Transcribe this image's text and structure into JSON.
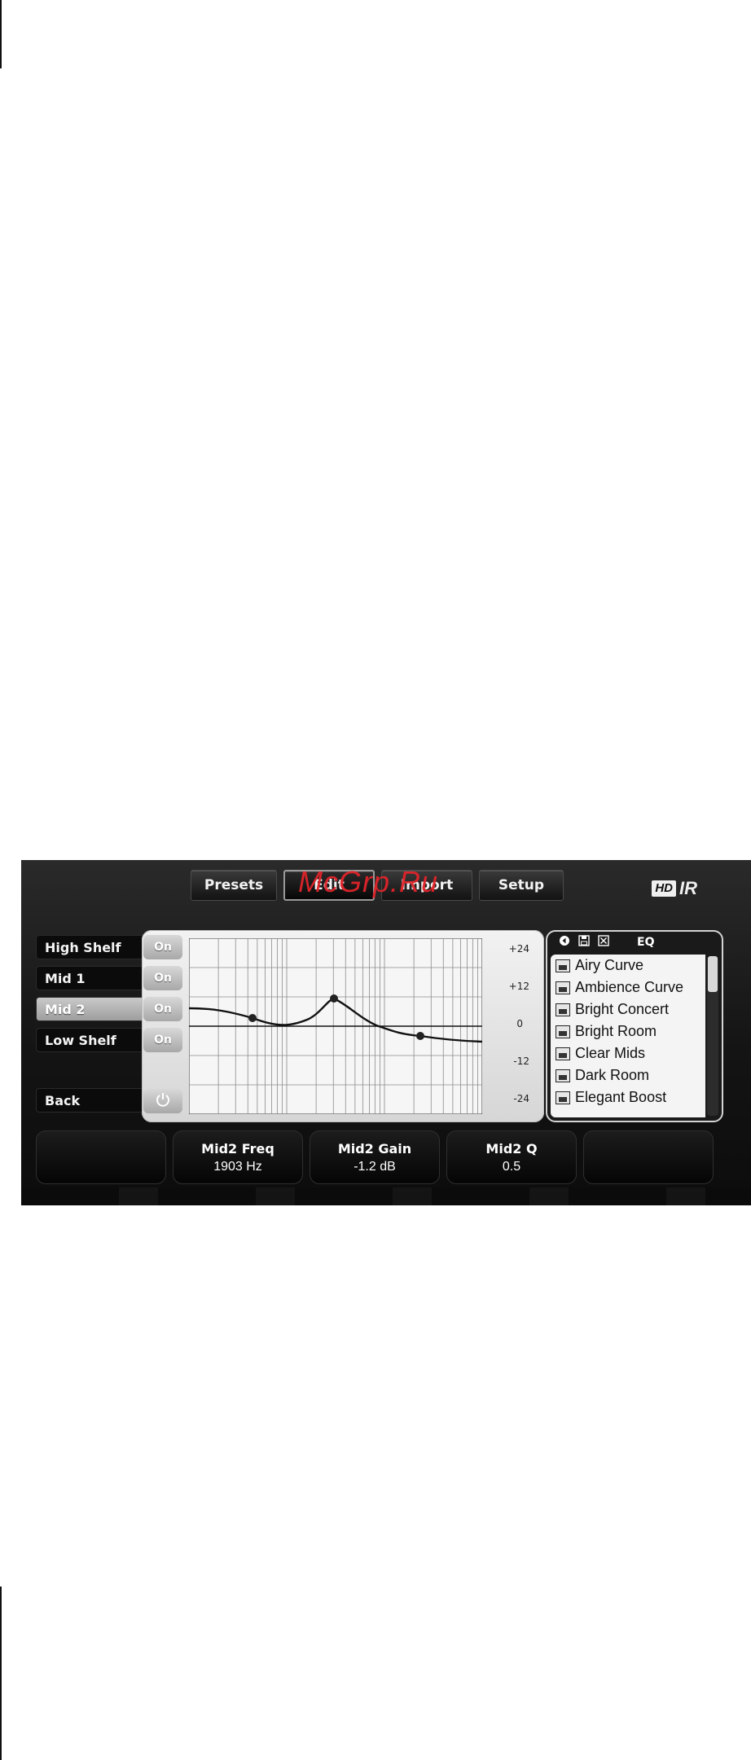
{
  "watermark": "McGrp.Ru",
  "toolbar": {
    "presets": "Presets",
    "edit": "Edit",
    "import": "Import",
    "setup": "Setup"
  },
  "brand": {
    "hd": "HD",
    "ir": "IR"
  },
  "bands": [
    {
      "label": "High Shelf",
      "active": false
    },
    {
      "label": "Mid 1",
      "active": false
    },
    {
      "label": "Mid 2",
      "active": true
    },
    {
      "label": "Low Shelf",
      "active": false
    }
  ],
  "back_label": "Back",
  "on_labels": [
    "On",
    "On",
    "On",
    "On"
  ],
  "graph": {
    "db_labels": [
      "+24",
      "+12",
      "0",
      "-12",
      "-24"
    ],
    "grid_color": "#8a8a8a",
    "curve_color": "#111111"
  },
  "preset_panel": {
    "title": "EQ",
    "items": [
      "Airy Curve",
      "Ambience Curve",
      "Bright Concert",
      "Bright Room",
      "Clear Mids",
      "Dark Room",
      "Elegant Boost"
    ]
  },
  "params": [
    {
      "name": "",
      "value": ""
    },
    {
      "name": "Mid2 Freq",
      "value": "1903 Hz"
    },
    {
      "name": "Mid2 Gain",
      "value": "-1.2 dB"
    },
    {
      "name": "Mid2 Q",
      "value": "0.5"
    },
    {
      "name": "",
      "value": ""
    }
  ]
}
